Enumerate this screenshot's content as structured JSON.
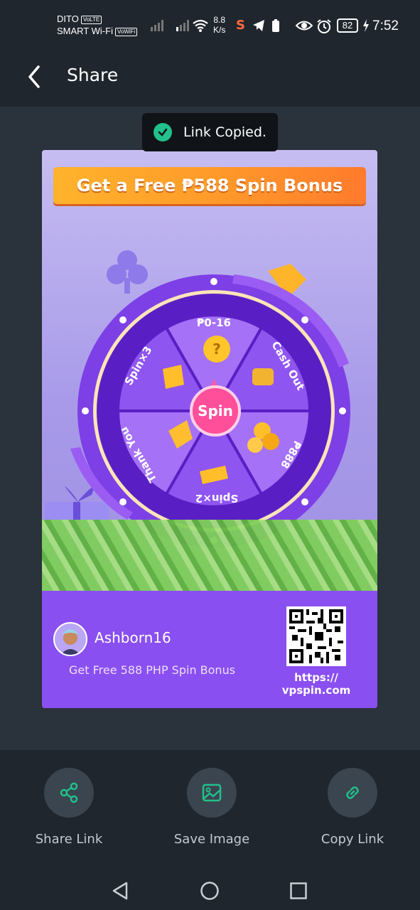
{
  "status_bar": {
    "carrier_1": "DITO",
    "carrier_1_tag": "VoLTE",
    "carrier_2": "SMART Wi-Fi",
    "carrier_2_tag": "VoWiFi",
    "net_speed_value": "8.8",
    "net_speed_unit": "K/s",
    "battery": "82",
    "time": "7:52",
    "icons": [
      "signal-icon",
      "signal-icon",
      "wifi-icon",
      "app-s-icon",
      "telegram-icon",
      "battery-saver-icon",
      "eye-icon",
      "alarm-icon",
      "charging-icon"
    ]
  },
  "header": {
    "back_icon": "back-arrow-icon",
    "title": "Share"
  },
  "toast": {
    "icon": "check-circle-icon",
    "text": "Link Copied."
  },
  "card": {
    "banner": "Get a Free ₱588 Spin Bonus",
    "wheel": {
      "center_label": "Spin",
      "segments": [
        "₱0-16",
        "Cash Out",
        "₱888",
        "Spin×2",
        "Thank You",
        "Spin×3"
      ]
    },
    "footer": {
      "username": "Ashborn16",
      "promo": "Get Free 588 PHP Spin Bonus",
      "url_line_1": "https://",
      "url_line_2": "vpspin.com"
    }
  },
  "actions": [
    {
      "label": "Share Link",
      "icon": "share-icon"
    },
    {
      "label": "Save Image",
      "icon": "image-icon"
    },
    {
      "label": "Copy Link",
      "icon": "link-icon"
    }
  ],
  "navbar": [
    "back-triangle-icon",
    "home-circle-icon",
    "recents-square-icon"
  ],
  "colors": {
    "accent": "#22c08a",
    "banner_orange": "#ff9b2a",
    "card_purple": "#8a4ff0",
    "background": "#2a323b"
  }
}
